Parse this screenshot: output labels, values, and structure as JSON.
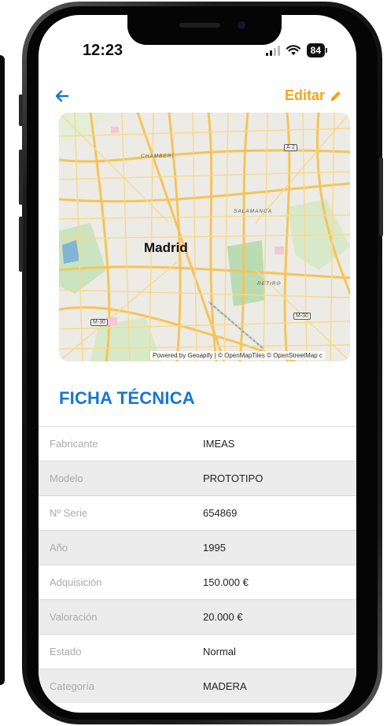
{
  "status_bar": {
    "time": "12:23",
    "battery": "84"
  },
  "header": {
    "back_icon": "arrow-left-icon",
    "edit_label": "Editar",
    "edit_icon": "pencil-icon",
    "edit_color": "#f5a416",
    "back_color": "#1776d4"
  },
  "map": {
    "city_label": "Madrid",
    "district_labels": [
      "CHAMBERÍ",
      "SALAMANCA",
      "RETIRO"
    ],
    "road_shields": [
      "A-2",
      "M-30",
      "M-30"
    ],
    "credit": "Powered by Geoapify | © OpenMapTiles © OpenStreetMap c"
  },
  "spec": {
    "title": "FICHA TÉCNICA",
    "title_color": "#1776d4",
    "rows": [
      {
        "label": "Fabricante",
        "value": "IMEAS"
      },
      {
        "label": "Modelo",
        "value": "PROTOTIPO"
      },
      {
        "label": "Nº Serie",
        "value": "654869"
      },
      {
        "label": "Año",
        "value": "1995"
      },
      {
        "label": "Adquisición",
        "value": "150.000 €"
      },
      {
        "label": "Valoración",
        "value": "20.000 €"
      },
      {
        "label": "Estado",
        "value": "Normal"
      },
      {
        "label": "Categoría",
        "value": "MADERA"
      }
    ]
  }
}
